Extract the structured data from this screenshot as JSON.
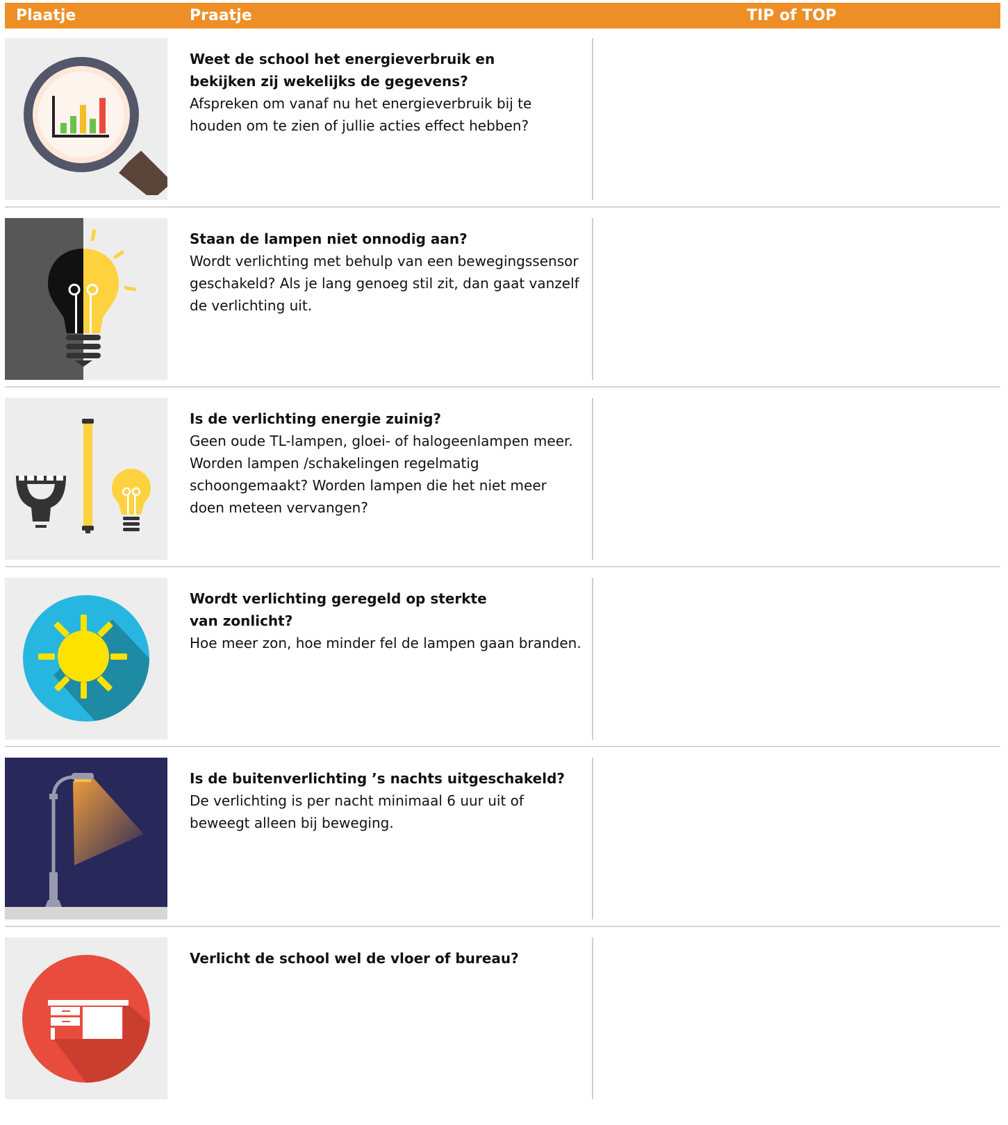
{
  "header": {
    "col_image": "Plaatje",
    "col_text": "Praatje",
    "col_tip": "TIP of TOP",
    "bg_color": "#ee8e26"
  },
  "rows": [
    {
      "icon": "magnifier-chart-icon",
      "question": "Weet de school het energieverbruik en\nbekijken zij wekelijks de gegevens?",
      "description": "Afspreken om vanaf nu het energieverbruik bij te\nhouden om te zien of jullie acties effect hebben?"
    },
    {
      "icon": "light-bulb-icon",
      "question": "Staan de lampen niet onnodig aan?",
      "description": "Wordt verlichting met behulp van een bewegingssensor\ngeschakeld? Als je lang genoeg stil zit, dan gaat vanzelf\nde verlichting uit."
    },
    {
      "icon": "lamp-types-icon",
      "question": "Is de verlichting energie zuinig?",
      "description": "Geen oude TL-lampen, gloei- of halogeenlampen meer.\nWorden lampen /schakelingen regelmatig\nschoongemaakt? Worden lampen die het niet meer\ndoen meteen vervangen?"
    },
    {
      "icon": "sun-icon",
      "question": "Wordt verlichting geregeld op sterkte\nvan zonlicht?",
      "description": "Hoe meer zon, hoe minder fel de lampen gaan branden."
    },
    {
      "icon": "street-lamp-icon",
      "question": "Is de buitenverlichting ’s nachts uitgeschakeld?",
      "description": "De verlichting is per nacht minimaal 6 uur uit of\nbeweegt alleen bij beweging."
    },
    {
      "icon": "desk-icon",
      "question": "Verlicht de school wel de vloer of bureau?",
      "description": ""
    }
  ]
}
